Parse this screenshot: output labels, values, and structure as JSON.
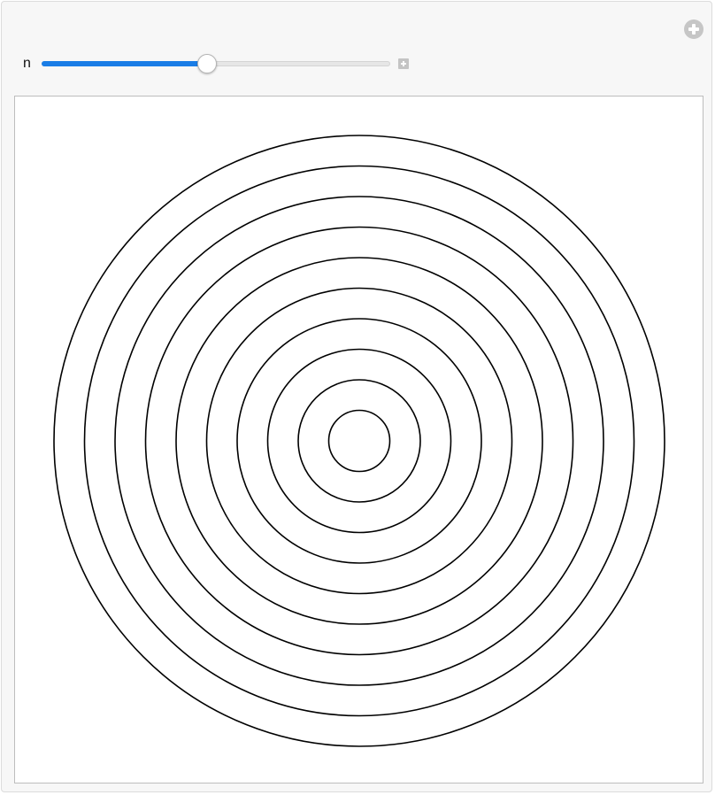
{
  "controls": {
    "slider": {
      "label": "n",
      "fraction": 0.4746,
      "fill_color": "#1a7de6"
    },
    "add_control_icon": "plus-circle-icon",
    "slider_options_icon": "plus-square-icon"
  },
  "plot": {
    "ring_count": 10,
    "stroke_color": "#000000"
  }
}
